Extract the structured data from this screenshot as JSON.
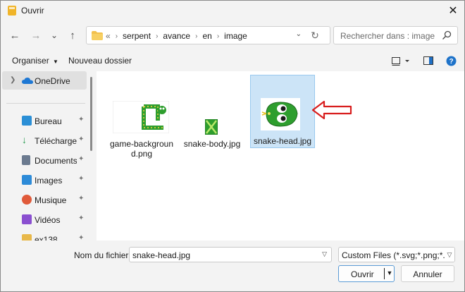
{
  "window": {
    "title": "Ouvrir",
    "close_symbol": "✕"
  },
  "nav": {
    "back_symbol": "←",
    "forward_symbol": "→",
    "recent_symbol": "⌄",
    "up_symbol": "↑",
    "breadcrumb": {
      "overflow": "«",
      "items": [
        "serpent",
        "avance",
        "en",
        "image"
      ],
      "separator": "›"
    },
    "dropdown_symbol": "⌄",
    "refresh_symbol": "↻",
    "search_placeholder": "Rechercher dans : image"
  },
  "toolbar": {
    "organize_label": "Organiser",
    "new_folder_label": "Nouveau dossier"
  },
  "navpane": {
    "top_item": {
      "label": "OneDrive",
      "icon": "cloud-icon"
    },
    "items": [
      {
        "label": "Bureau",
        "icon": "desktop-icon",
        "color": "#2b8fd6"
      },
      {
        "label": "Téléchargem",
        "icon": "download-icon",
        "color": "#2e9e55"
      },
      {
        "label": "Documents",
        "icon": "document-icon",
        "color": "#6b7a8f"
      },
      {
        "label": "Images",
        "icon": "image-icon",
        "color": "#2d8bd8"
      },
      {
        "label": "Musique",
        "icon": "music-icon",
        "color": "#e05a3a"
      },
      {
        "label": "Vidéos",
        "icon": "video-icon",
        "color": "#8a4fd0"
      },
      {
        "label": "ex138",
        "icon": "folder-icon",
        "color": "#e8b84a"
      }
    ],
    "pin_symbol": "📌"
  },
  "files": [
    {
      "name": "game-background.png",
      "name_line1": "game-backgroun",
      "name_line2": "d.png",
      "icon": "game-background-thumbnail"
    },
    {
      "name": "snake-body.jpg",
      "icon": "snake-body-thumbnail"
    },
    {
      "name": "snake-head.jpg",
      "icon": "snake-head-thumbnail",
      "selected": true
    }
  ],
  "annotation": {
    "icon": "red-arrow-icon",
    "color": "#d81e1e"
  },
  "bottom": {
    "filename_label": "Nom du fichier :",
    "filename_value": "snake-head.jpg",
    "filter_value": "Custom Files (*.svg;*.png;*.bmp;",
    "open_label": "Ouvrir",
    "cancel_label": "Annuler"
  },
  "colors": {
    "accent": "#0067c0",
    "selection": "#cce4f7",
    "snake_green": "#2e9e2e"
  }
}
